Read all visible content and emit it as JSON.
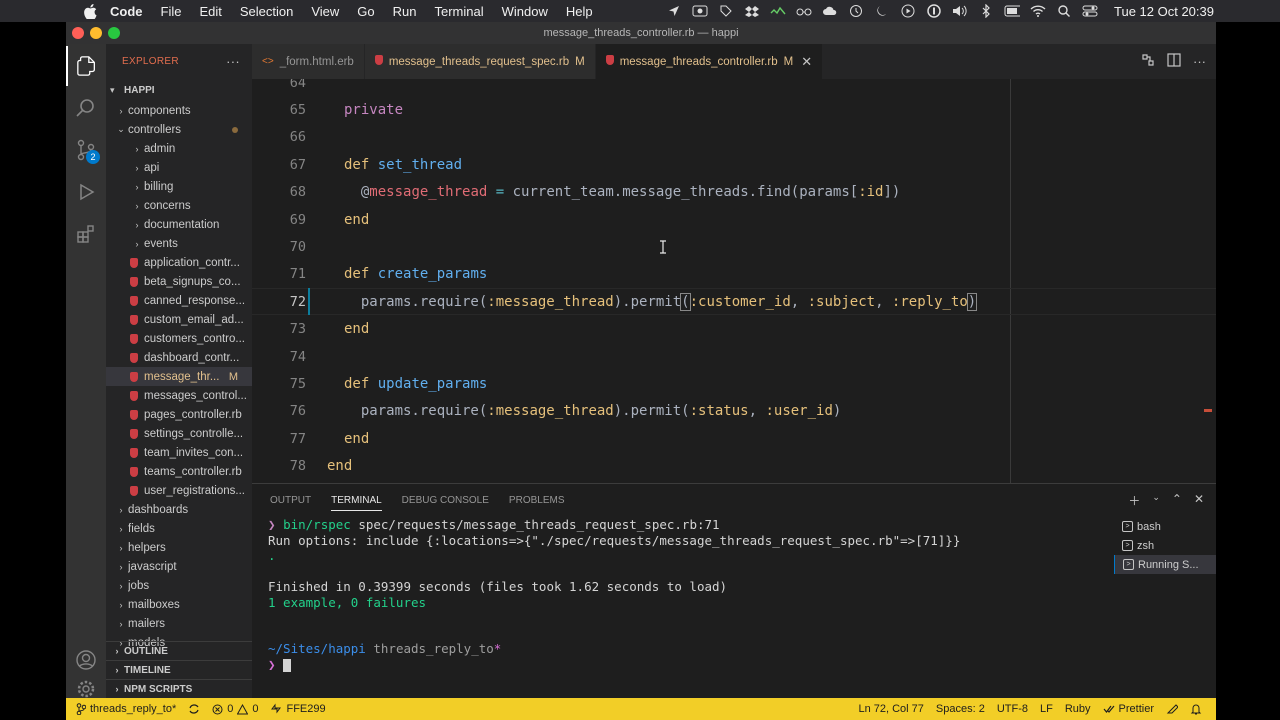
{
  "menubar": {
    "app_name": "Code",
    "items": [
      "File",
      "Edit",
      "Selection",
      "View",
      "Go",
      "Run",
      "Terminal",
      "Window",
      "Help"
    ],
    "clock": "Tue 12 Oct  20:39"
  },
  "window": {
    "title": "message_threads_controller.rb — happi"
  },
  "activity_badge": "2",
  "sidebar": {
    "header": "EXPLORER",
    "project": "HAPPI",
    "tree": [
      {
        "label": "components",
        "type": "folder",
        "depth": 1
      },
      {
        "label": "controllers",
        "type": "folder-open",
        "depth": 1,
        "dot": true
      },
      {
        "label": "admin",
        "type": "folder",
        "depth": 2
      },
      {
        "label": "api",
        "type": "folder",
        "depth": 2
      },
      {
        "label": "billing",
        "type": "folder",
        "depth": 2
      },
      {
        "label": "concerns",
        "type": "folder",
        "depth": 2
      },
      {
        "label": "documentation",
        "type": "folder",
        "depth": 2
      },
      {
        "label": "events",
        "type": "folder",
        "depth": 2
      },
      {
        "label": "application_contr...",
        "type": "ruby",
        "depth": 2
      },
      {
        "label": "beta_signups_co...",
        "type": "ruby",
        "depth": 2
      },
      {
        "label": "canned_response...",
        "type": "ruby",
        "depth": 2
      },
      {
        "label": "custom_email_ad...",
        "type": "ruby",
        "depth": 2
      },
      {
        "label": "customers_contro...",
        "type": "ruby",
        "depth": 2
      },
      {
        "label": "dashboard_contr...",
        "type": "ruby",
        "depth": 2
      },
      {
        "label": "message_thr...",
        "type": "ruby",
        "depth": 2,
        "selected": true,
        "modified": "M"
      },
      {
        "label": "messages_control...",
        "type": "ruby",
        "depth": 2
      },
      {
        "label": "pages_controller.rb",
        "type": "ruby",
        "depth": 2
      },
      {
        "label": "settings_controlle...",
        "type": "ruby",
        "depth": 2
      },
      {
        "label": "team_invites_con...",
        "type": "ruby",
        "depth": 2
      },
      {
        "label": "teams_controller.rb",
        "type": "ruby",
        "depth": 2
      },
      {
        "label": "user_registrations...",
        "type": "ruby",
        "depth": 2
      },
      {
        "label": "dashboards",
        "type": "folder",
        "depth": 1
      },
      {
        "label": "fields",
        "type": "folder",
        "depth": 1
      },
      {
        "label": "helpers",
        "type": "folder",
        "depth": 1
      },
      {
        "label": "javascript",
        "type": "folder",
        "depth": 1
      },
      {
        "label": "jobs",
        "type": "folder",
        "depth": 1
      },
      {
        "label": "mailboxes",
        "type": "folder",
        "depth": 1
      },
      {
        "label": "mailers",
        "type": "folder",
        "depth": 1
      },
      {
        "label": "models",
        "type": "folder",
        "depth": 1
      }
    ],
    "sections": [
      "OUTLINE",
      "TIMELINE",
      "NPM SCRIPTS"
    ]
  },
  "tabs": [
    {
      "label": "_form.html.erb",
      "icon": "<>",
      "modified": ""
    },
    {
      "label": "message_threads_request_spec.rb",
      "icon": "ruby",
      "modified": "M"
    },
    {
      "label": "message_threads_controller.rb",
      "icon": "ruby",
      "modified": "M",
      "active": true
    }
  ],
  "editor": {
    "line_numbers": [
      "64",
      "65",
      "66",
      "67",
      "68",
      "69",
      "70",
      "71",
      "72",
      "73",
      "74",
      "75",
      "76",
      "77",
      "78"
    ],
    "current_line": "72"
  },
  "panel": {
    "tabs": [
      "OUTPUT",
      "TERMINAL",
      "DEBUG CONSOLE",
      "PROBLEMS"
    ],
    "active_tab": "TERMINAL",
    "terminal": {
      "cmd_prefix": "❯",
      "cmd": "bin/rspec",
      "cmd_arg": " spec/requests/message_threads_request_spec.rb:71",
      "run_options": "Run options: include {:locations=>{\"./spec/requests/message_threads_request_spec.rb\"=>[71]}}",
      "dot": ".",
      "finished": "Finished in 0.39399 seconds (files took 1.62 seconds to load)",
      "result": "1 example, 0 failures",
      "path": "~/Sites/happi",
      "branch": " threads_reply_to",
      "branch_star": "*",
      "prompt": "❯"
    },
    "terminals": [
      "bash",
      "zsh",
      "Running S..."
    ]
  },
  "statusbar": {
    "branch": "threads_reply_to*",
    "errors": "0",
    "warnings": "0",
    "commit": "FFE299",
    "position": "Ln 72, Col 77",
    "spaces": "Spaces: 2",
    "encoding": "UTF-8",
    "eol": "LF",
    "language": "Ruby",
    "formatter": "Prettier"
  },
  "colors": {
    "accent": "#007acc",
    "statusbar": "#f2ce27",
    "modified": "#e2c08d"
  }
}
